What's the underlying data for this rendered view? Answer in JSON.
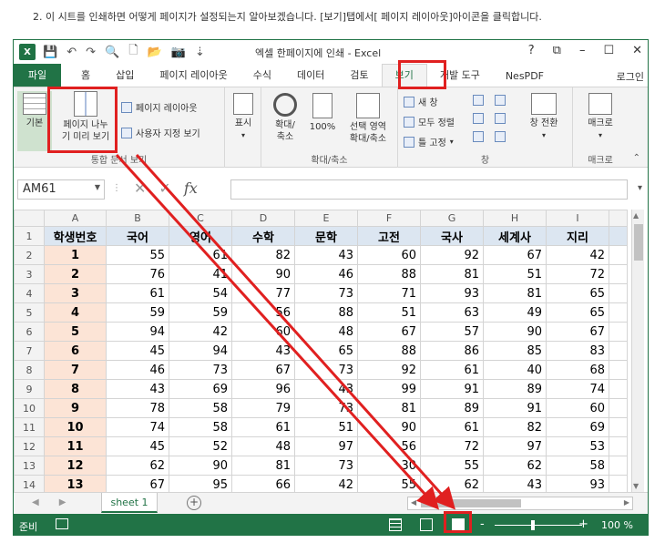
{
  "caption": "2. 이 시트를 인쇄하면 어떻게 페이지가 설정되는지 알아보겠습니다. [보기]탭에서[ 페이지 레이아웃]아이콘을 클릭합니다.",
  "app": {
    "title": "엑셀 한페이지에 인쇄 - Excel",
    "logo": "X",
    "window_buttons": [
      "?",
      "⧉",
      "–",
      "☐",
      "✕"
    ]
  },
  "tabs": [
    "파일",
    "홈",
    "삽입",
    "페이지 레이아웃",
    "수식",
    "데이터",
    "검토",
    "보기",
    "개발 도구",
    "NesPDF"
  ],
  "active_tab": "보기",
  "login_label": "로그인",
  "ribbon": {
    "workbook_views": {
      "normal": "기본",
      "page_break_preview": [
        "페이지 나누",
        "기 미리 보기"
      ],
      "page_layout": "페이지 레이아웃",
      "custom_views": "사용자 지정 보기",
      "group_label": "통합 문서 보기"
    },
    "show": {
      "label": "표시"
    },
    "zoom": {
      "zoom": [
        "확대/",
        "축소"
      ],
      "hundred": "100%",
      "selection": [
        "선택 영역",
        "확대/축소"
      ],
      "group_label": "확대/축소"
    },
    "window": {
      "new_window": "새 창",
      "arrange_all": "모두 정렬",
      "freeze": "틀 고정",
      "switch": [
        "창 전환"
      ],
      "group_label": "창"
    },
    "macros": {
      "label": [
        "매크로"
      ],
      "group_label": "매크로"
    }
  },
  "formula_bar": {
    "name_box": "AM61",
    "fx": "fx",
    "value": ""
  },
  "grid": {
    "columns": [
      "A",
      "B",
      "C",
      "D",
      "E",
      "F",
      "G",
      "H",
      "I"
    ],
    "headers": [
      "학생번호",
      "국어",
      "영어",
      "수학",
      "문학",
      "고전",
      "국사",
      "세계사",
      "지리"
    ],
    "rows": [
      [
        1,
        55,
        61,
        82,
        43,
        60,
        92,
        67,
        42
      ],
      [
        2,
        76,
        41,
        90,
        46,
        88,
        81,
        51,
        72
      ],
      [
        3,
        61,
        54,
        77,
        73,
        71,
        93,
        81,
        65
      ],
      [
        4,
        59,
        59,
        56,
        88,
        51,
        63,
        49,
        65
      ],
      [
        5,
        94,
        42,
        60,
        48,
        67,
        57,
        90,
        67
      ],
      [
        6,
        45,
        94,
        43,
        65,
        88,
        86,
        85,
        83
      ],
      [
        7,
        46,
        73,
        67,
        73,
        92,
        61,
        40,
        68
      ],
      [
        8,
        43,
        69,
        96,
        43,
        99,
        91,
        89,
        74
      ],
      [
        9,
        78,
        58,
        79,
        73,
        81,
        89,
        91,
        60
      ],
      [
        10,
        74,
        58,
        61,
        51,
        90,
        61,
        82,
        69
      ],
      [
        11,
        45,
        52,
        48,
        97,
        56,
        72,
        97,
        53
      ],
      [
        12,
        62,
        90,
        81,
        73,
        30,
        55,
        62,
        58
      ],
      [
        13,
        67,
        95,
        66,
        42,
        55,
        62,
        43,
        93
      ]
    ]
  },
  "sheet": {
    "tab": "sheet 1",
    "add": "+"
  },
  "status": {
    "ready": "준비",
    "zoom": "100 %",
    "minus": "-",
    "plus": "+"
  },
  "colors": {
    "excel_green": "#217346",
    "highlight_red": "#e02020",
    "header_fill": "#dce6f1",
    "id_fill": "#fce4d6"
  }
}
